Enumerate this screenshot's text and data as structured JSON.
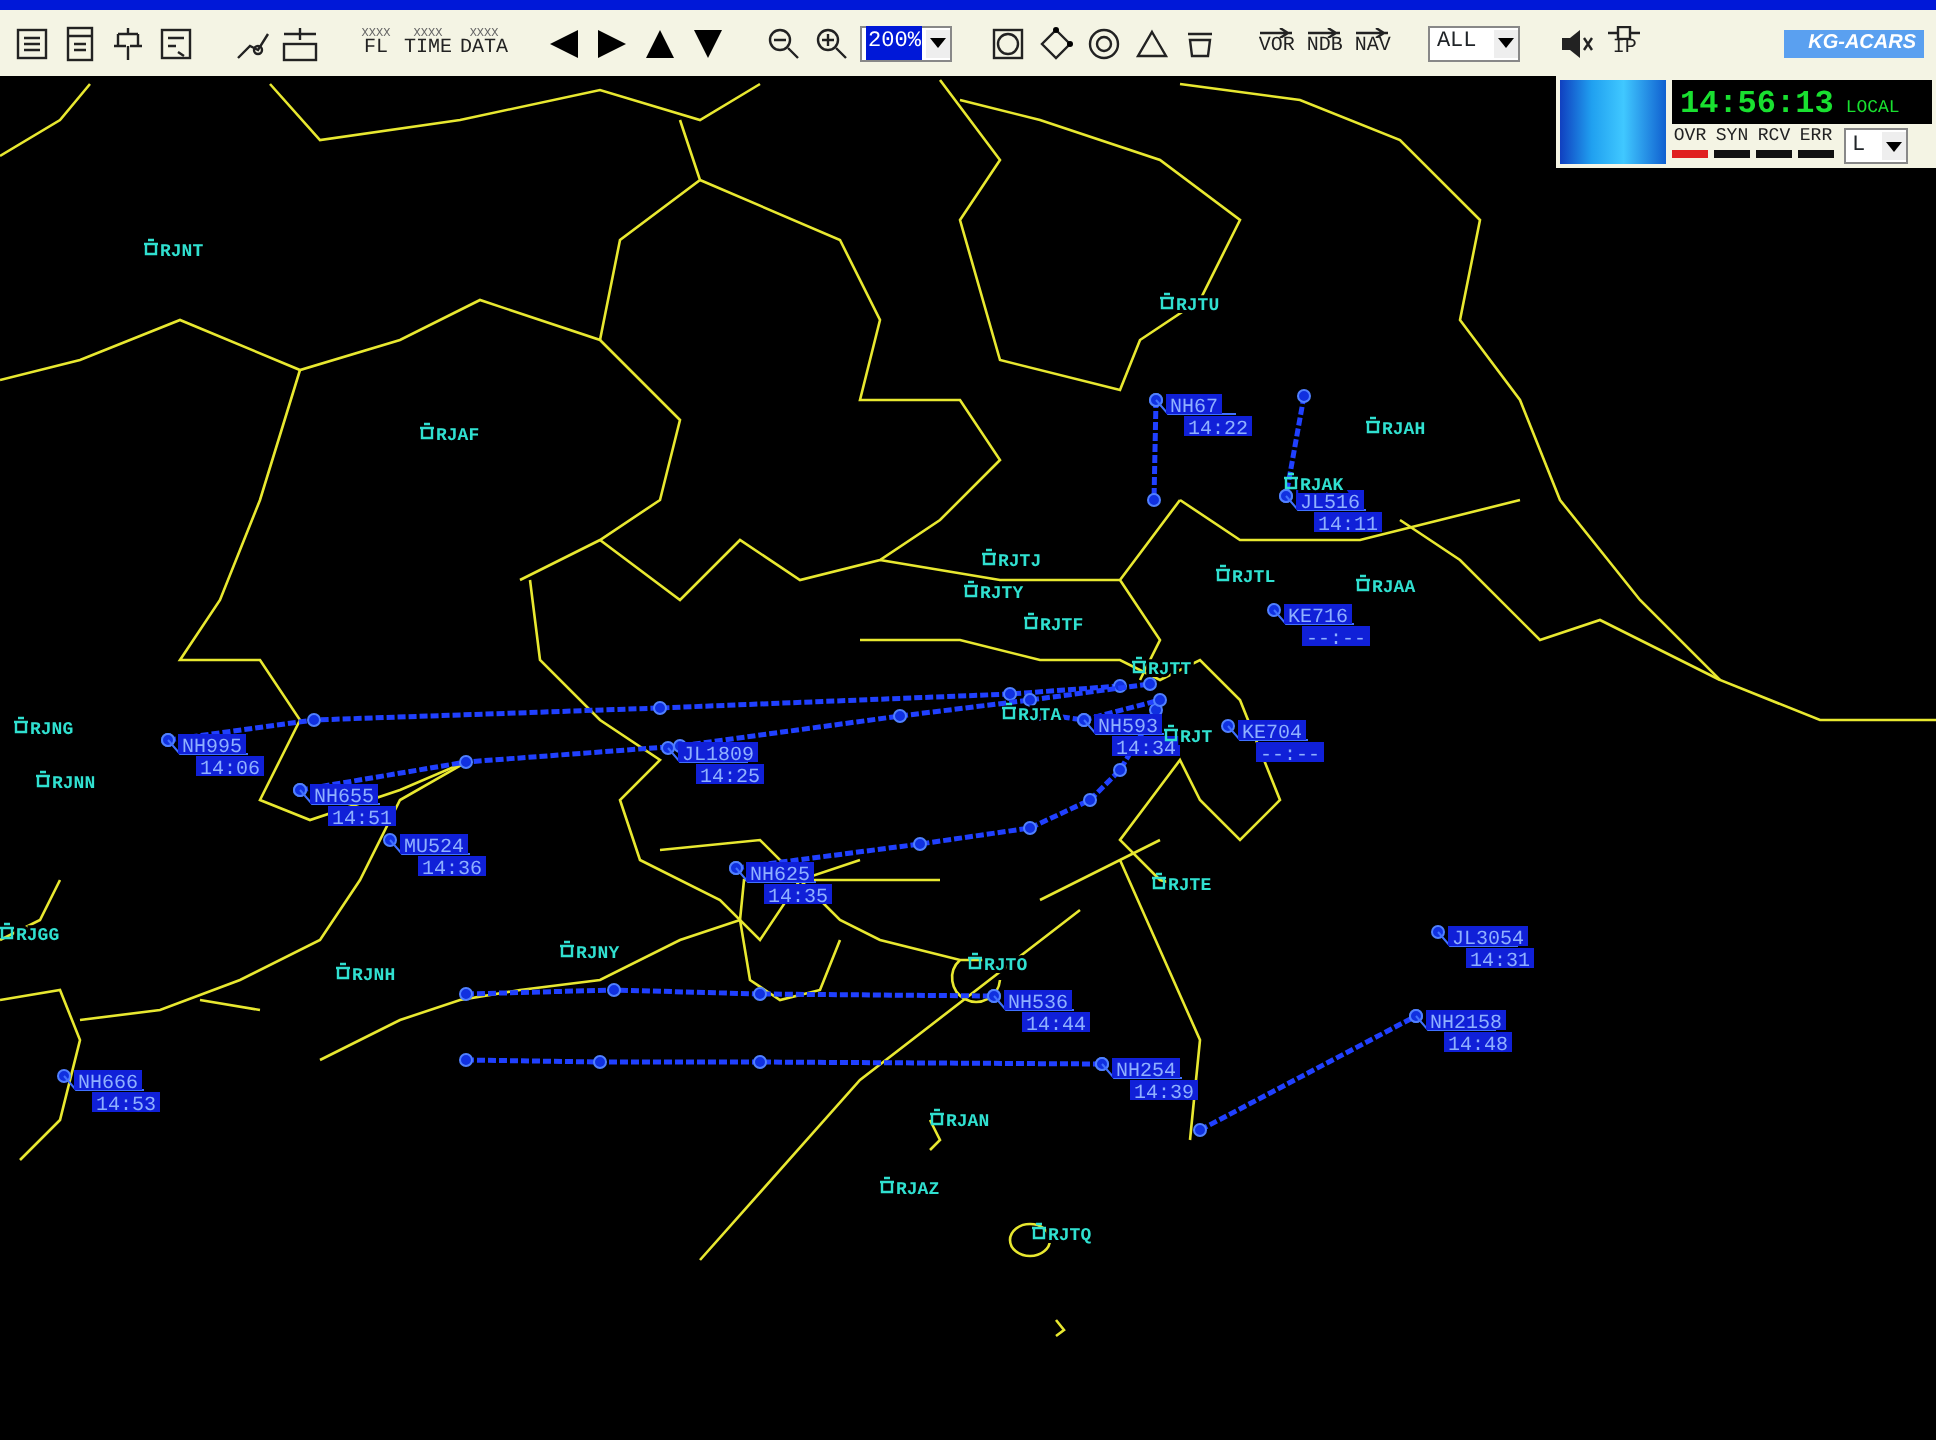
{
  "toolbar": {
    "data_buttons": [
      {
        "caption": "XXXX",
        "label": "FL"
      },
      {
        "caption": "XXXX",
        "label": "TIME"
      },
      {
        "caption": "XXXX",
        "label": "DATA"
      }
    ],
    "zoom_select": {
      "value": "200%"
    },
    "navaid_buttons": [
      "VOR",
      "NDB",
      "NAV"
    ],
    "filter_select": {
      "value": "ALL"
    },
    "ip_button": "IP",
    "logo": "KG-ACARS"
  },
  "status_panel": {
    "clock": "14:56:13",
    "clock_mode": "LOCAL",
    "indicators": [
      {
        "label": "OVR",
        "on": true
      },
      {
        "label": "SYN",
        "on": false
      },
      {
        "label": "RCV",
        "on": false
      },
      {
        "label": "ERR",
        "on": false
      }
    ],
    "channel_select": {
      "value": "L"
    }
  },
  "map": {
    "airports": [
      "RJNT",
      "RJTU",
      "RJAF",
      "RJAH",
      "RJAK",
      "RJTJ",
      "RJTY",
      "RJTL",
      "RJAA",
      "RJTF",
      "RJTT",
      "RJTA",
      "RJT",
      "RJNG",
      "RJNN",
      "RJGG",
      "RJNH",
      "RJNY",
      "RJTO",
      "RJTE",
      "RJAN",
      "RJAZ",
      "RJTQ"
    ],
    "flights": [
      {
        "callsign": "NH995",
        "time": "14:06"
      },
      {
        "callsign": "NH655",
        "time": "14:51"
      },
      {
        "callsign": "JL1809",
        "time": "14:25"
      },
      {
        "callsign": "MU524",
        "time": "14:36"
      },
      {
        "callsign": "NH625",
        "time": "14:35"
      },
      {
        "callsign": "NH593",
        "time": "14:34"
      },
      {
        "callsign": "NH67",
        "time": "14:22"
      },
      {
        "callsign": "JL516",
        "time": "14:11"
      },
      {
        "callsign": "KE716",
        "time": "--:--"
      },
      {
        "callsign": "KE704",
        "time": "--:--"
      },
      {
        "callsign": "NH536",
        "time": "14:44"
      },
      {
        "callsign": "NH254",
        "time": "14:39"
      },
      {
        "callsign": "NH666",
        "time": "14:53"
      },
      {
        "callsign": "JL3054",
        "time": "14:31"
      },
      {
        "callsign": "NH2158",
        "time": "14:48"
      }
    ]
  }
}
